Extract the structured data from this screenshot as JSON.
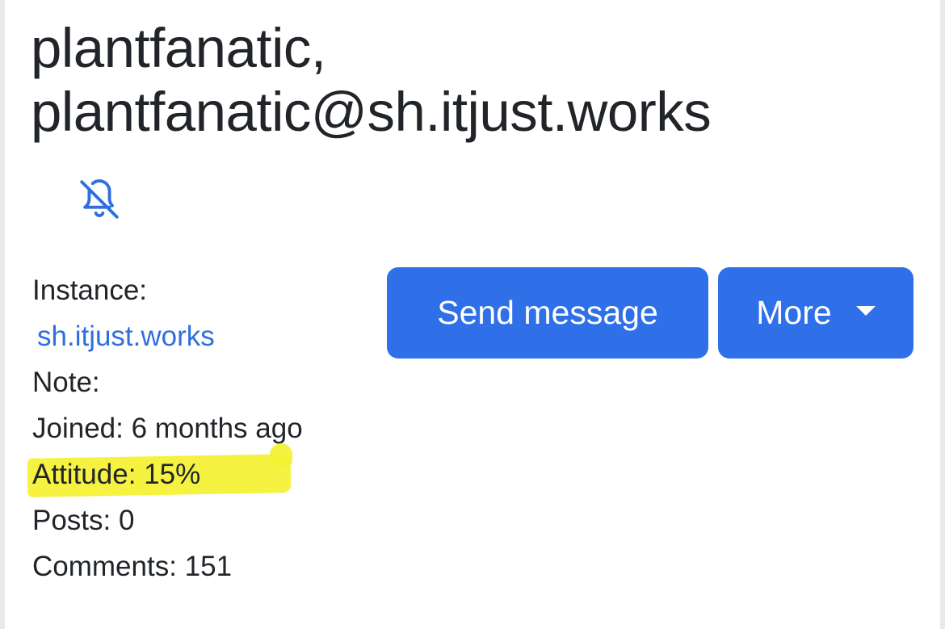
{
  "profile": {
    "title_line1": "plantfanatic,",
    "title_line2": "plantfanatic@sh.itjust.works",
    "mute_icon": "bell-slash-icon"
  },
  "info": {
    "instance_label": "Instance:",
    "instance_link": "sh.itjust.works",
    "note_label": "Note:",
    "joined": "Joined: 6 months ago",
    "attitude": "Attitude: 15%",
    "posts": "Posts: 0",
    "comments": "Comments: 151"
  },
  "actions": {
    "send_message_label": "Send message",
    "more_label": "More"
  },
  "colors": {
    "accent": "#2f6fe8",
    "link": "#2f6fe0",
    "highlight": "#f4f132",
    "text": "#212529"
  }
}
